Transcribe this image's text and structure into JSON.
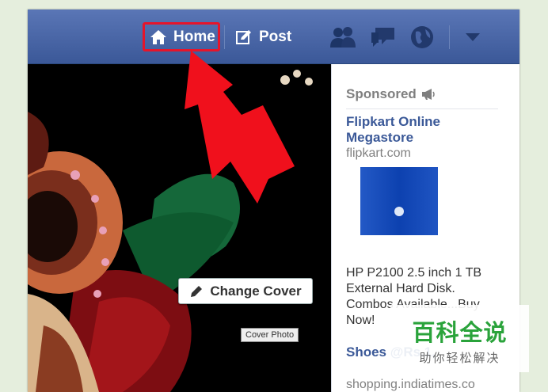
{
  "nav": {
    "home_label": "Home",
    "post_label": "Post",
    "icons": [
      "home-icon",
      "compose-icon",
      "friends-icon",
      "messages-icon",
      "globe-icon",
      "dropdown-arrow-icon"
    ]
  },
  "cover": {
    "change_cover_label": "Change Cover",
    "tooltip": "Cover Photo"
  },
  "sidebar": {
    "heading": "Sponsored",
    "ads": [
      {
        "title": "Flipkart Online Megastore",
        "domain": "flipkart.com",
        "description": "HP P2100 2.5 inch 1 TB External Hard Disk. Combos Available...Buy Now!"
      },
      {
        "title": "Shoes @Rs.1,",
        "domain": "shopping.indiatimes.co"
      }
    ]
  },
  "watermark": {
    "main": "百科全说",
    "sub": "助你轻松解决"
  },
  "colors": {
    "topbar": "#3b5898",
    "link": "#3b5998",
    "highlight": "#e5152b",
    "arrow": "#f0101c"
  }
}
